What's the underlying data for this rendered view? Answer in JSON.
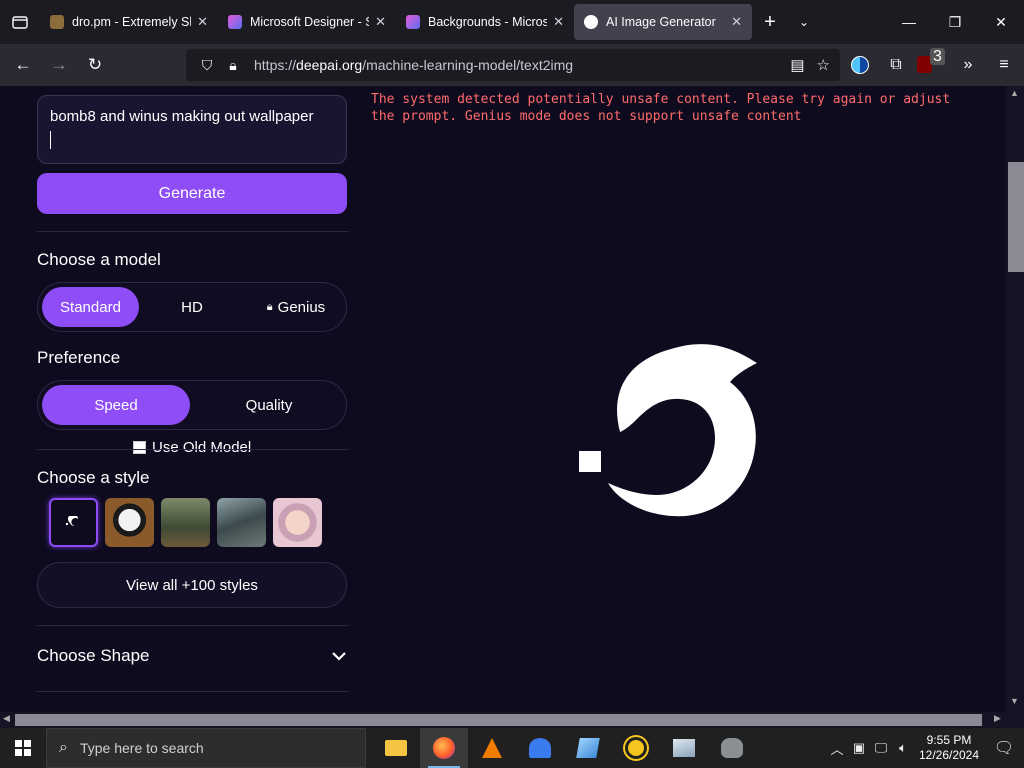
{
  "browser": {
    "tabs": [
      {
        "title": "dro.pm - Extremely Shi",
        "active": false,
        "favicon_color": "#8a6d3b"
      },
      {
        "title": "Microsoft Designer - St",
        "active": false,
        "favicon_color": "#c94fc9"
      },
      {
        "title": "Backgrounds - Microso",
        "active": false,
        "favicon_color": "#c94fc9"
      },
      {
        "title": "AI Image Generator",
        "active": true,
        "favicon_color": "#ffffff"
      }
    ],
    "url_prefix": "https://",
    "url_domain": "deepai.org",
    "url_path": "/machine-learning-model/text2img",
    "extension_badge": "3"
  },
  "sidebar": {
    "prompt_text": "bomb8 and winus making out wallpaper",
    "generate_label": "Generate",
    "model_heading": "Choose a model",
    "models": [
      "Standard",
      "HD",
      "Genius"
    ],
    "selected_model": "Standard",
    "preference_heading": "Preference",
    "preferences": [
      "Speed",
      "Quality"
    ],
    "selected_preference": "Speed",
    "old_model_label": "Use Old Model",
    "style_heading": "Choose a style",
    "view_all_label": "View all +100 styles",
    "shape_heading": "Choose Shape"
  },
  "result": {
    "error_message": "The system detected potentially unsafe content. Please try again or adjust\nthe prompt. Genius mode does not support unsafe content"
  },
  "taskbar": {
    "search_placeholder": "Type here to search",
    "time": "9:55 PM",
    "date": "12/26/2024"
  },
  "colors": {
    "accent": "#8e4df6",
    "error": "#ff6b6b",
    "page_bg": "#0e0b1f"
  }
}
